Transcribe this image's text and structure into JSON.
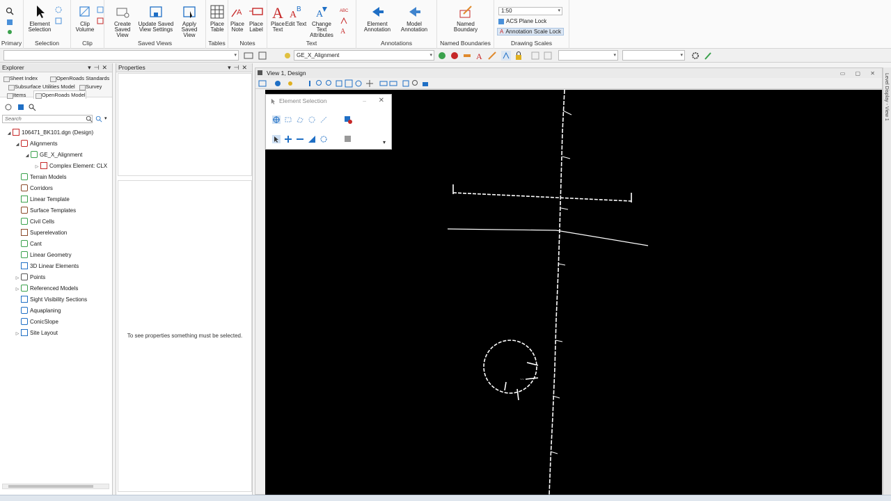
{
  "ribbon": {
    "groups": [
      {
        "label": "Primary"
      },
      {
        "label": "Selection"
      },
      {
        "label": "Clip"
      },
      {
        "label": "Saved Views"
      },
      {
        "label": "Tables"
      },
      {
        "label": "Notes"
      },
      {
        "label": "Text"
      },
      {
        "label": "Annotations"
      },
      {
        "label": "Named Boundaries"
      },
      {
        "label": "Drawing Scales"
      }
    ],
    "buttons": {
      "element_selection": "Element Selection",
      "clip_volume": "Clip Volume",
      "create_saved_view": "Create Saved View",
      "update_saved_view": "Update Saved View Settings",
      "apply_saved_view": "Apply Saved View",
      "place_table": "Place Table",
      "place_note": "Place Note",
      "place_label": "Place Label",
      "place_text": "Place Text",
      "edit_text": "Edit Text",
      "change_text_attributes": "Change Text Attributes",
      "element_annotation": "Element Annotation",
      "model_annotation": "Model Annotation",
      "named_boundary": "Named Boundary"
    },
    "scale_value": "1:50",
    "acs_plane_lock": "ACS Plane Lock",
    "annotation_scale_lock": "Annotation Scale Lock"
  },
  "toolbar2": {
    "level_value": "GE_X_Alignment"
  },
  "explorer": {
    "title": "Explorer",
    "tabs": [
      "Sheet Index",
      "OpenRoads Standards",
      "Subsurface Utilities Model",
      "Survey",
      "Items",
      "OpenRoads Model"
    ],
    "search_placeholder": "Search",
    "tree": [
      {
        "label": "106471_BK101.dgn (Design)",
        "level": 0,
        "expander": "open"
      },
      {
        "label": "Alignments",
        "level": 1,
        "expander": "open"
      },
      {
        "label": "GE_X_Alignment",
        "level": 2,
        "expander": "open"
      },
      {
        "label": "Complex Element: CLX",
        "level": 3,
        "expander": "closed"
      },
      {
        "label": "Terrain Models",
        "level": 1,
        "expander": "none"
      },
      {
        "label": "Corridors",
        "level": 1,
        "expander": "none"
      },
      {
        "label": "Linear Template",
        "level": 1,
        "expander": "none"
      },
      {
        "label": "Surface Templates",
        "level": 1,
        "expander": "none"
      },
      {
        "label": "Civil Cells",
        "level": 1,
        "expander": "none"
      },
      {
        "label": "Superelevation",
        "level": 1,
        "expander": "none"
      },
      {
        "label": "Cant",
        "level": 1,
        "expander": "none"
      },
      {
        "label": "Linear Geometry",
        "level": 1,
        "expander": "none"
      },
      {
        "label": "3D Linear Elements",
        "level": 1,
        "expander": "none"
      },
      {
        "label": "Points",
        "level": 1,
        "expander": "closed"
      },
      {
        "label": "Referenced Models",
        "level": 1,
        "expander": "closed"
      },
      {
        "label": "Sight Visibility Sections",
        "level": 1,
        "expander": "none"
      },
      {
        "label": "Aquaplaning",
        "level": 1,
        "expander": "none"
      },
      {
        "label": "ConicSlope",
        "level": 1,
        "expander": "none"
      },
      {
        "label": "Site Layout",
        "level": 1,
        "expander": "closed"
      }
    ]
  },
  "properties": {
    "title": "Properties",
    "empty_message": "To see properties something must be selected."
  },
  "view": {
    "title": "View 1, Design"
  },
  "element_selection": {
    "title": "Element Selection"
  },
  "right_strip": {
    "label": "Level Display - View 1"
  },
  "colors": {
    "canvas_bg": "#000000",
    "accent_blue": "#1f6fc5",
    "accent_red": "#c62828"
  }
}
